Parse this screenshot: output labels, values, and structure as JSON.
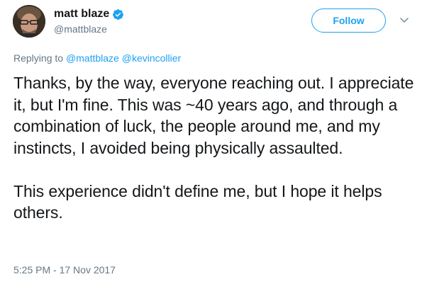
{
  "author": {
    "display_name": "matt blaze",
    "handle": "@mattblaze",
    "verified": true
  },
  "follow_button": {
    "label": "Follow"
  },
  "menu": {
    "icon": "chevron-down-icon"
  },
  "reply_context": {
    "prefix": "Replying to",
    "mentions": [
      "@mattblaze",
      "@kevincollier"
    ]
  },
  "tweet": {
    "paragraphs": [
      "Thanks, by the way, everyone reaching out. I appreciate it, but I'm fine. This was ~40 years ago, and through a combination of luck, the people around me, and my instincts, I avoided being physically assaulted.",
      "This experience didn't define me, but I hope it helps others."
    ],
    "timestamp": "5:25 PM - 17 Nov 2017"
  },
  "colors": {
    "accent": "#1da1f2",
    "text": "#14171a",
    "secondary": "#657786"
  }
}
